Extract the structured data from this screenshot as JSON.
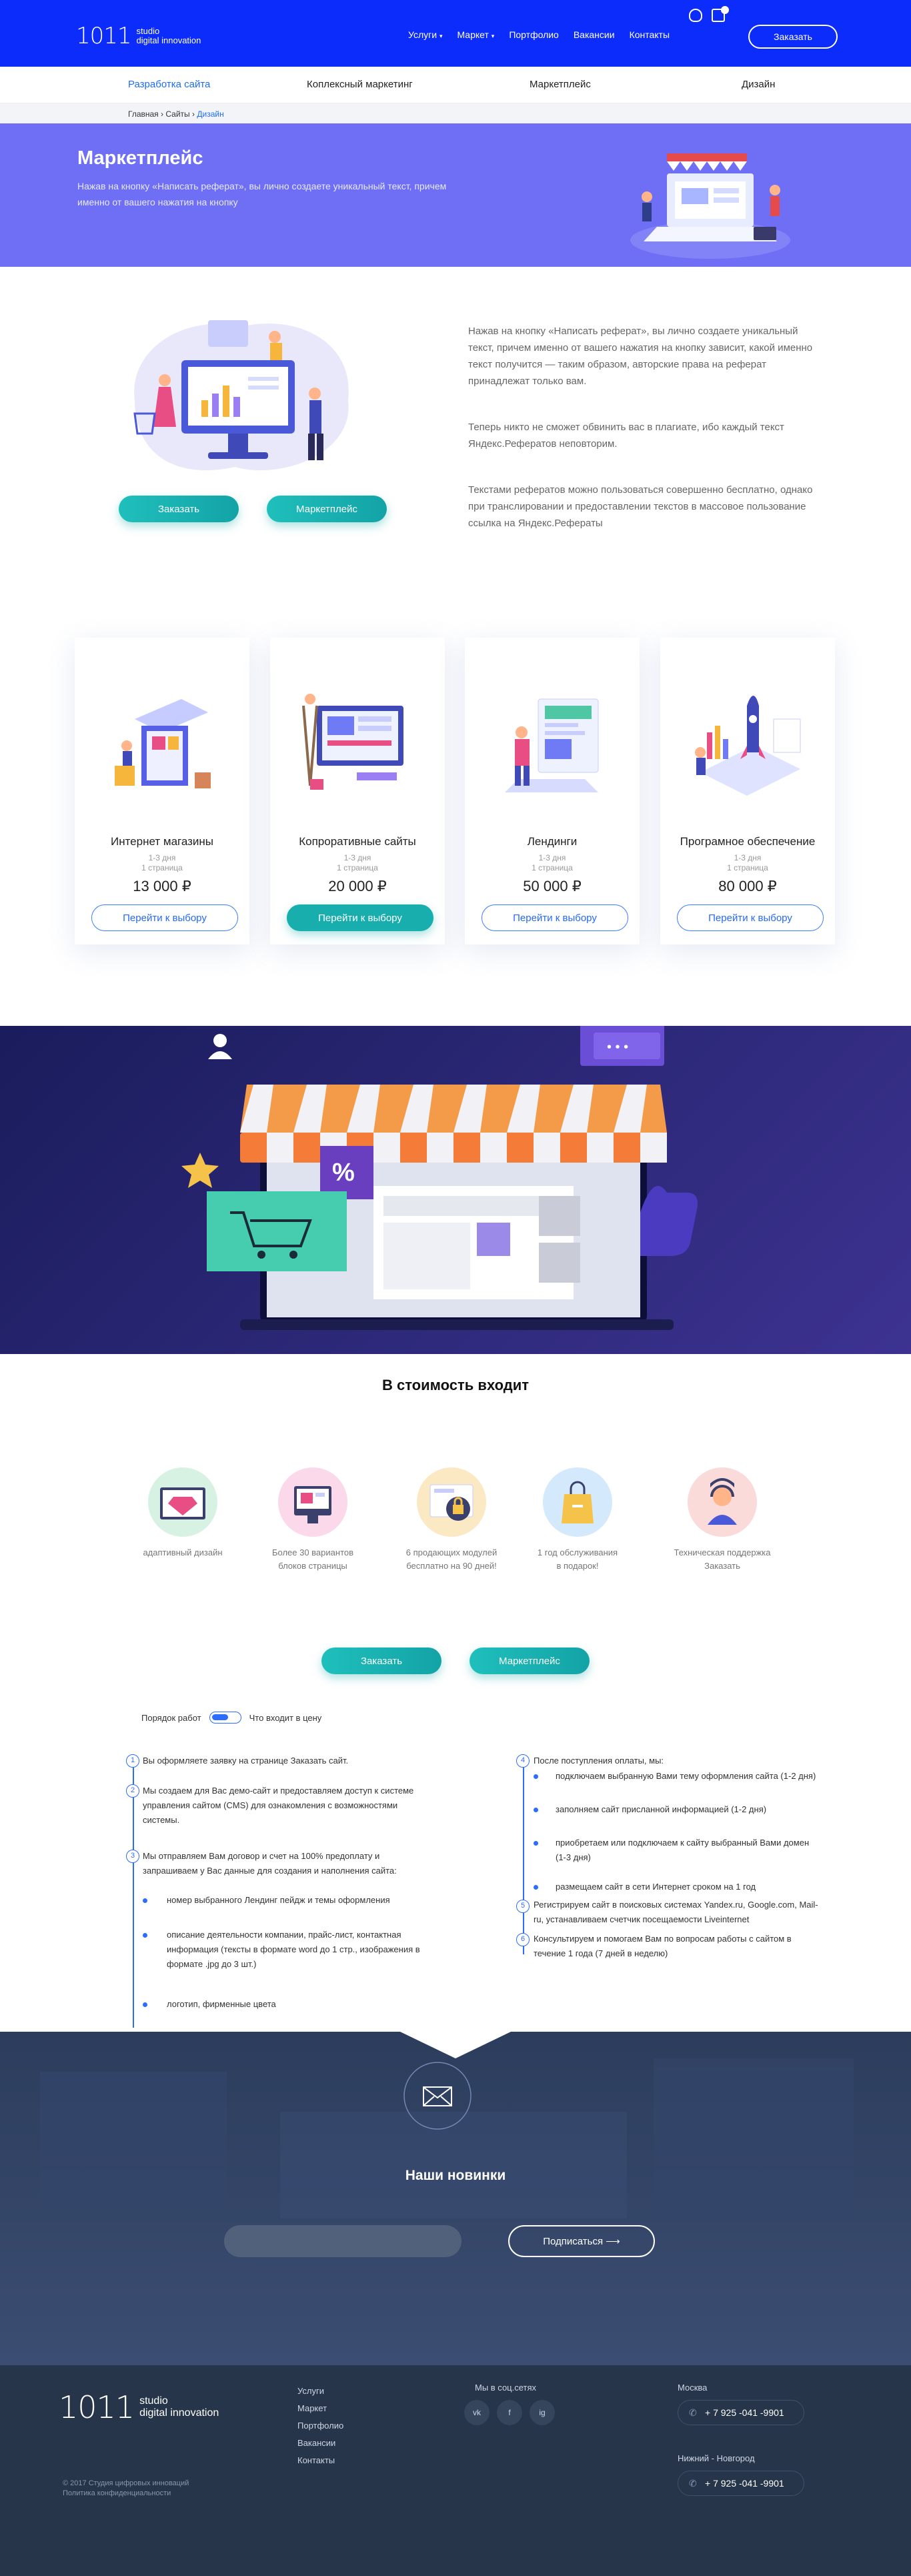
{
  "header": {
    "logo_num": "1011",
    "logo_line1": "studio",
    "logo_line2": "digital innovation",
    "nav": [
      "Услуги",
      "Маркет",
      "Портфолио",
      "Вакансии",
      "Контакты"
    ],
    "order_label": "Заказать"
  },
  "subnav": [
    "Разработка сайта",
    "Коплексный маркетинг",
    "Маркетплейс",
    "Дизайн"
  ],
  "breadcrumbs": {
    "home": "Главная",
    "sep1": "›",
    "sites": "Сайты",
    "sep2": "›",
    "current": "Дизайн"
  },
  "hero": {
    "title": "Маркетплейс",
    "text": "Нажав на кнопку «Написать реферат», вы лично создаете уникальный текст, причем именно от вашего нажатия на кнопку"
  },
  "intro": {
    "p1": "Нажав на кнопку «Написать реферат», вы лично создаете уникальный текст, причем именно от вашего нажатия на кнопку зависит, какой именно текст получится — таким образом, авторские права на реферат принадлежат только вам.",
    "p2": "Теперь никто не сможет обвинить вас в плагиате, ибо каждый текст Яндекс.Рефератов неповторим.",
    "p3": "Текстами рефератов можно пользоваться совершенно бесплатно, однако при транслировании и предоставлении текстов в массовое пользование ссылка на Яндекс.Рефераты",
    "btn_order": "Заказать",
    "btn_market": "Маркетплейс"
  },
  "cards": [
    {
      "title": "Интернет магазины",
      "days": "1-3 дня",
      "pages": "1 страница",
      "price": "13 000 ₽",
      "button": "Перейти к выбору"
    },
    {
      "title": "Копроративные сайты",
      "days": "1-3 дня",
      "pages": "1 страница",
      "price": "20 000 ₽",
      "button": "Перейти к выбору"
    },
    {
      "title": "Лендинги",
      "days": "1-3 дня",
      "pages": "1 страница",
      "price": "50 000 ₽",
      "button": "Перейти к выбору"
    },
    {
      "title": "Програмное обеспечение",
      "days": "1-3 дня",
      "pages": "1 страница",
      "price": "80 000 ₽",
      "button": "Перейти к выбору"
    }
  ],
  "banner": {
    "percent": "%",
    "dots": "• • •"
  },
  "includes": {
    "title": "В стоимость входит",
    "items": [
      {
        "l1": "адаптивный дизайн",
        "l2": ""
      },
      {
        "l1": "Более 30 вариантов",
        "l2": "блоков страницы"
      },
      {
        "l1": "6 продающих модулей",
        "l2": "бесплатно на 90 дней!"
      },
      {
        "l1": "1 год обслуживания",
        "l2": "в подарок!"
      },
      {
        "l1": "Техническая поддержка",
        "l2": "Заказать"
      }
    ],
    "btn_order": "Заказать",
    "btn_market": "Маркетплейс"
  },
  "toggle": {
    "left": "Порядок работ",
    "right": "Что входит в цену"
  },
  "steps_left": {
    "s1": "Вы оформляете заявку на странице Заказать сайт.",
    "s2a": "Мы создаем для Вас демо-сайт и предоставляем доступ к системе",
    "s2b": "управления сайтом (CMS) для ознакомления с возможностями",
    "s2c": "системы.",
    "s3a": "Мы отправляем Вам договор и счет на 100% предоплату и",
    "s3b": "запрашиваем у Вас данные для создания и наполнения сайта:",
    "b1": "номер выбранного Лендинг пейдж и темы оформления",
    "b2a": "описание деятельности компании, прайс-лист, контактная",
    "b2b": "информация (тексты в формате word до 1 стр., изображения в",
    "b2c": "формате .jpg до 3 шт.)",
    "b3": "логотип, фирменные цвета"
  },
  "steps_right": {
    "s4": "После поступления оплаты, мы:",
    "b1": "подключаем выбранную Вами тему оформления сайта (1-2 дня)",
    "b2": "заполняем сайт присланной информацией (1-2 дня)",
    "b3a": "приобретаем или подключаем к сайту выбранный Вами домен",
    "b3b": "(1-3 дня)",
    "b4": "размещаем сайт в сети Интернет сроком на 1 год",
    "s5a": "Регистрируем сайт в поисковых системах Yandex.ru, Google.com, Mail-",
    "s5b": "ru, устанавливаем счетчик посещаемости Liveinternet",
    "s6a": "Консультируем и помогаем Вам по вопросам работы с сайтом в",
    "s6b": "течение 1 года (7 дней в неделю)"
  },
  "newsletter": {
    "title": "Наши новинки",
    "subscribe": "Подписаться"
  },
  "footer": {
    "logo_num": "1011",
    "logo_line1": "studio",
    "logo_line2": "digital innovation",
    "links": [
      "Услуги",
      "Маркет",
      "Портфолио",
      "Вакансии",
      "Контакты"
    ],
    "social_title": "Мы в соц.сетях",
    "social": [
      "vk",
      "f",
      "ig"
    ],
    "city1": "Москва",
    "phone1": "+ 7 925 -041 -9901",
    "city2": "Нижний - Новгород",
    "phone2": "+ 7 925 -041 -9901",
    "copyright": "© 2017 Студия цифровых инноваций",
    "policy": "Политика конфиденциальности"
  },
  "colors": {
    "brand_blue": "#0c2cfb",
    "hero_purple": "#6f6ff5",
    "teal": "#19aeae",
    "banner": "#2a2770",
    "footer": "#263549"
  }
}
